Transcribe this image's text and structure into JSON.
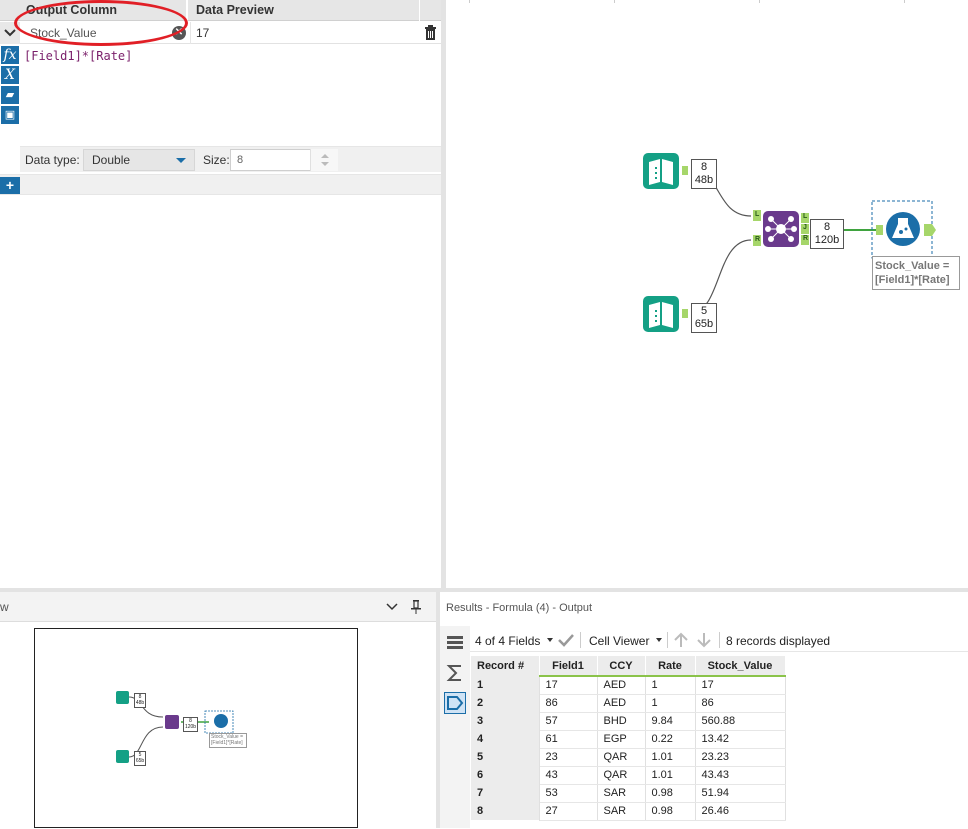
{
  "formula": {
    "headers": {
      "output_column": "Output Column",
      "data_preview": "Data Preview"
    },
    "row": {
      "output_field": "Stock_Value",
      "preview": "17"
    },
    "expression": "[Field1]*[Rate]",
    "toolbar_icons": [
      "fx-icon",
      "variable-icon",
      "open-icon",
      "save-icon"
    ],
    "options": {
      "datatype_label": "Data type:",
      "datatype_value": "Double",
      "size_label": "Size:",
      "size_value": "8"
    },
    "add_label": "+"
  },
  "canvas": {
    "input1_badge": {
      "count": "8",
      "size": "48b"
    },
    "input2_badge": {
      "count": "5",
      "size": "65b"
    },
    "join_badge": {
      "count": "8",
      "size": "120b"
    },
    "join_anchors": {
      "left": "L",
      "right": "R",
      "out_left": "L",
      "out_join": "J",
      "out_right": "R"
    },
    "formula_annotation_line1": "Stock_Value =",
    "formula_annotation_line2": "[Field1]*[Rate]",
    "colors": {
      "input": "#14a085",
      "join": "#6a3a8c",
      "formula": "#1b6ea8",
      "connector": "#8bc34a"
    }
  },
  "overview": {
    "title_fragment": "w",
    "mini": {
      "input1_count": "8",
      "input1_size": "48b",
      "input2_count": "5",
      "input2_size": "65b",
      "join_count": "8",
      "join_size": "120b",
      "annot1": "Stock_Value =",
      "annot2": "[Field1]*[Rate]"
    }
  },
  "results": {
    "title": "Results - Formula (4) - Output",
    "fields_label": "4 of 4 Fields",
    "viewer_label": "Cell Viewer",
    "records_label": "8 records displayed",
    "columns": [
      "Record #",
      "Field1",
      "CCY",
      "Rate",
      "Stock_Value"
    ],
    "rows": [
      [
        "1",
        "17",
        "AED",
        "1",
        "17"
      ],
      [
        "2",
        "86",
        "AED",
        "1",
        "86"
      ],
      [
        "3",
        "57",
        "BHD",
        "9.84",
        "560.88"
      ],
      [
        "4",
        "61",
        "EGP",
        "0.22",
        "13.42"
      ],
      [
        "5",
        "23",
        "QAR",
        "1.01",
        "23.23"
      ],
      [
        "6",
        "43",
        "QAR",
        "1.01",
        "43.43"
      ],
      [
        "7",
        "53",
        "SAR",
        "0.98",
        "51.94"
      ],
      [
        "8",
        "27",
        "SAR",
        "0.98",
        "26.46"
      ]
    ]
  }
}
